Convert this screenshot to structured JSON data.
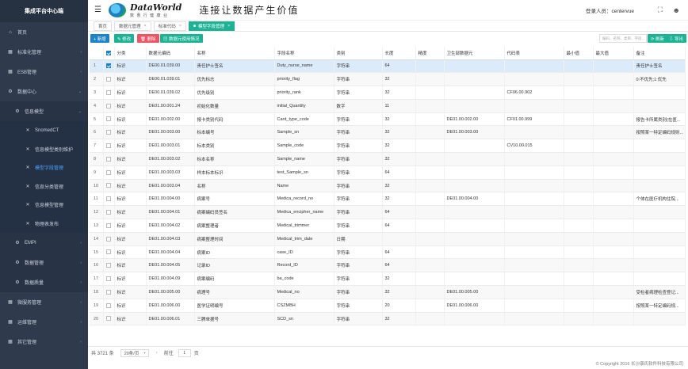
{
  "sidebar": {
    "brand": "集成平台中心端",
    "items": [
      {
        "icon": "home-icon",
        "glyph": "⌂",
        "label": "首页",
        "chevron": ""
      },
      {
        "icon": "grid-icon",
        "glyph": "▦",
        "label": "标准化管理",
        "chevron": "‹"
      },
      {
        "icon": "grid-icon",
        "glyph": "▦",
        "label": "ESB管理",
        "chevron": "‹"
      },
      {
        "icon": "gear-icon",
        "glyph": "⚙",
        "label": "数据中心",
        "chevron": "⌄"
      },
      {
        "icon": "gear-icon",
        "glyph": "⚙",
        "label": "信息模型",
        "chevron": "⌄"
      },
      {
        "icon": "wrench-icon",
        "glyph": "✕",
        "label": "SnomedCT",
        "chevron": ""
      },
      {
        "icon": "wrench-icon",
        "glyph": "✕",
        "label": "信息模型类别维护",
        "chevron": ""
      },
      {
        "icon": "wrench-icon",
        "glyph": "✕",
        "label": "模型字段管理",
        "chevron": ""
      },
      {
        "icon": "wrench-icon",
        "glyph": "✕",
        "label": "信息分类管理",
        "chevron": ""
      },
      {
        "icon": "wrench-icon",
        "glyph": "✕",
        "label": "信息模型管理",
        "chevron": ""
      },
      {
        "icon": "wrench-icon",
        "glyph": "✕",
        "label": "物理表发布",
        "chevron": ""
      },
      {
        "icon": "gear-icon",
        "glyph": "⚙",
        "label": "EMPI",
        "chevron": "‹"
      },
      {
        "icon": "gear-icon",
        "glyph": "⚙",
        "label": "数据管理",
        "chevron": "‹"
      },
      {
        "icon": "gear-icon",
        "glyph": "⚙",
        "label": "数据质量",
        "chevron": "‹"
      },
      {
        "icon": "grid-icon",
        "glyph": "▦",
        "label": "微服务管理",
        "chevron": "‹"
      },
      {
        "icon": "grid-icon",
        "glyph": "▦",
        "label": "运维管理",
        "chevron": "‹"
      },
      {
        "icon": "grid-icon",
        "glyph": "▦",
        "label": "其它管理",
        "chevron": "‹"
      }
    ]
  },
  "header": {
    "logo_main": "DataWorld",
    "logo_sub": "数 惠 行 健 康 业",
    "slogan": "连接让数据产生价值",
    "login_label": "登录人员：centervue",
    "fullscreen_glyph": "⛶",
    "user_glyph": "☻"
  },
  "tabs": [
    {
      "label": "首页",
      "closable": false
    },
    {
      "label": "数据元管理",
      "closable": true
    },
    {
      "label": "标准代码",
      "closable": true
    },
    {
      "label": "模型字段管理",
      "closable": true
    }
  ],
  "toolbar": {
    "add": "+ 新增",
    "edit": "✎ 修改",
    "delete": "🗑 删除",
    "usage": "▤ 数据元使用情况",
    "search_placeholder": "编码、名称、类目、字段...",
    "refresh": "⟳ 刷新",
    "export": "⇩ 导出"
  },
  "table": {
    "headers": [
      "",
      "分类",
      "数据元编码",
      "名称",
      "字段名称",
      "类别",
      "长度",
      "精度",
      "卫生部数据元",
      "代码表",
      "最小值",
      "最大值",
      "备注"
    ],
    "rows": [
      [
        "1",
        "标识",
        "DE00.01.039.00",
        "责任护士签名",
        "Duty_nurse_name",
        "字符串",
        "64",
        "",
        "",
        "",
        "",
        "",
        "责任护士签名"
      ],
      [
        "2",
        "标识",
        "DE00.01.039.01",
        "优先标志",
        "priority_flag",
        "字符串",
        "32",
        "",
        "",
        "",
        "",
        "",
        "0:不优先;1:优先"
      ],
      [
        "3",
        "标识",
        "DE00.01.039.02",
        "优先级别",
        "priority_rank",
        "字符串",
        "32",
        "",
        "",
        "CF06.00.902",
        "",
        "",
        ""
      ],
      [
        "4",
        "标识",
        "DE01.00.001.24",
        "初始化数量",
        "initial_Quantity",
        "数字",
        "11",
        "",
        "",
        "",
        "",
        "",
        ""
      ],
      [
        "5",
        "标识",
        "DE01.00.002.00",
        "报卡类别代码",
        "Card_type_code",
        "字符串",
        "32",
        "",
        "DE01.00.002.00",
        "CF01.00.999",
        "",
        "",
        "报告卡所属类别(在医..."
      ],
      [
        "6",
        "标识",
        "DE01.00.003.00",
        "标本编号",
        "Sample_sn",
        "字符串",
        "32",
        "",
        "DE01.00.003.00",
        "",
        "",
        "",
        "按照某一特定编码规则..."
      ],
      [
        "7",
        "标识",
        "DE01.00.003.01",
        "标本类别",
        "Sample_code",
        "字符串",
        "32",
        "",
        "",
        "CV10.00.015",
        "",
        "",
        ""
      ],
      [
        "8",
        "标识",
        "DE01.00.003.02",
        "标本名称",
        "Sample_name",
        "字符串",
        "32",
        "",
        "",
        "",
        "",
        "",
        ""
      ],
      [
        "9",
        "标识",
        "DE01.00.003.03",
        "样本标本标识",
        "test_Sample_sn",
        "字符串",
        "64",
        "",
        "",
        "",
        "",
        "",
        ""
      ],
      [
        "10",
        "标识",
        "DE01.00.003.04",
        "名称",
        "Name",
        "字符串",
        "32",
        "",
        "",
        "",
        "",
        "",
        ""
      ],
      [
        "11",
        "标识",
        "DE01.00.004.00",
        "病案号",
        "Medica_record_no",
        "字符串",
        "32",
        "",
        "DE01.00.004.00",
        "",
        "",
        "",
        "个体在医疗机构住院..."
      ],
      [
        "12",
        "标识",
        "DE01.00.004.01",
        "病案编码员签名",
        "Medica_encipher_name",
        "字符串",
        "64",
        "",
        "",
        "",
        "",
        "",
        ""
      ],
      [
        "13",
        "标识",
        "DE01.00.004.02",
        "病案整理者",
        "Medical_trimmer",
        "字符串",
        "64",
        "",
        "",
        "",
        "",
        "",
        ""
      ],
      [
        "14",
        "标识",
        "DE01.00.004.03",
        "病案整理时间",
        "Medical_trim_date",
        "日期",
        "",
        "",
        "",
        "",
        "",
        "",
        ""
      ],
      [
        "15",
        "标识",
        "DE01.00.004.04",
        "病案ID",
        "case_ID",
        "字符串",
        "64",
        "",
        "",
        "",
        "",
        "",
        ""
      ],
      [
        "16",
        "标识",
        "DE01.00.004.05",
        "记录ID",
        "Record_ID",
        "字符串",
        "64",
        "",
        "",
        "",
        "",
        "",
        ""
      ],
      [
        "17",
        "标识",
        "DE01.00.004.09",
        "病案编码",
        "ba_code",
        "字符串",
        "32",
        "",
        "",
        "",
        "",
        "",
        ""
      ],
      [
        "18",
        "标识",
        "DE01.00.005.00",
        "病理号",
        "Medical_no",
        "字符串",
        "32",
        "",
        "DE01.00.005.00",
        "",
        "",
        "",
        "受检者病理检查登记..."
      ],
      [
        "19",
        "标识",
        "DE01.00.006.00",
        "医学证明编号",
        "CSZMBH",
        "字符串",
        "20",
        "",
        "DE01.00.006.00",
        "",
        "",
        "",
        "按照某一特定编码规..."
      ],
      [
        "20",
        "标识",
        "DE01.00.006.01",
        "三腾单据号",
        "SCD_sn",
        "字符串",
        "32",
        "",
        "",
        "",
        "",
        "",
        ""
      ]
    ],
    "selected_row": 0
  },
  "footer": {
    "total": "共 3721 条",
    "page_size": "20条/页",
    "prev": "‹",
    "goto_label": "前往",
    "page": "1",
    "page_unit": "页"
  },
  "copyright": "© Copyright 2016 长沙康氏软件科技有限公司"
}
